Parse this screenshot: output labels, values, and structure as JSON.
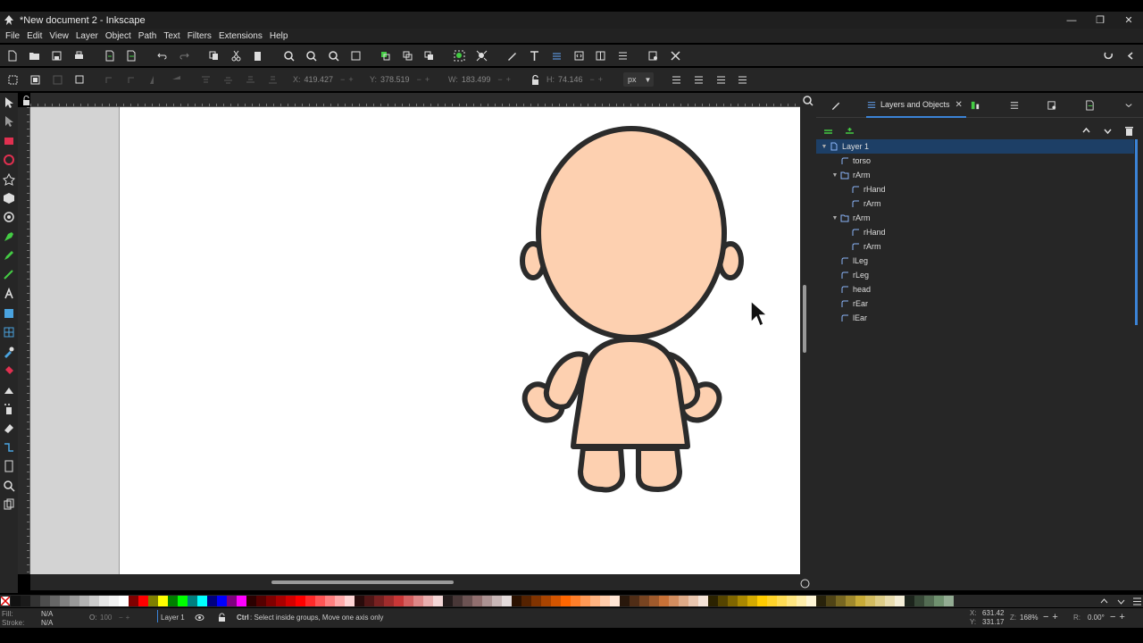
{
  "window": {
    "title": "*New document 2 - Inkscape"
  },
  "menu": [
    "File",
    "Edit",
    "View",
    "Layer",
    "Object",
    "Path",
    "Text",
    "Filters",
    "Extensions",
    "Help"
  ],
  "toolctl": {
    "x_label": "X:",
    "x_value": "419.427",
    "y_label": "Y:",
    "y_value": "378.519",
    "w_label": "W:",
    "w_value": "183.499",
    "h_label": "H:",
    "h_value": "74.146",
    "unit": "px"
  },
  "dock": {
    "active_tab": "Layers and Objects",
    "tree": [
      {
        "label": "Layer 1",
        "depth": 0,
        "kind": "layer",
        "expanded": true,
        "selected": true
      },
      {
        "label": "torso",
        "depth": 1,
        "kind": "path"
      },
      {
        "label": "rArm",
        "depth": 1,
        "kind": "group",
        "expanded": true
      },
      {
        "label": "rHand",
        "depth": 2,
        "kind": "path"
      },
      {
        "label": "rArm",
        "depth": 2,
        "kind": "path"
      },
      {
        "label": "rArm",
        "depth": 1,
        "kind": "group",
        "expanded": true
      },
      {
        "label": "rHand",
        "depth": 2,
        "kind": "path"
      },
      {
        "label": "rArm",
        "depth": 2,
        "kind": "path"
      },
      {
        "label": "lLeg",
        "depth": 1,
        "kind": "path"
      },
      {
        "label": "rLeg",
        "depth": 1,
        "kind": "path"
      },
      {
        "label": "head",
        "depth": 1,
        "kind": "path"
      },
      {
        "label": "rEar",
        "depth": 1,
        "kind": "path"
      },
      {
        "label": "lEar",
        "depth": 1,
        "kind": "path"
      }
    ]
  },
  "palette": [
    "#111111",
    "#1a1a1a",
    "#333333",
    "#4d4d4d",
    "#666666",
    "#808080",
    "#999999",
    "#b3b3b3",
    "#cccccc",
    "#e6e6e6",
    "#f2f2f2",
    "#ffffff",
    "#800000",
    "#ff0000",
    "#808000",
    "#ffff00",
    "#008000",
    "#00ff00",
    "#008080",
    "#00ffff",
    "#000080",
    "#0000ff",
    "#800080",
    "#ff00ff",
    "#2b0000",
    "#550000",
    "#800000",
    "#aa0000",
    "#d40000",
    "#ff0000",
    "#ff2a2a",
    "#ff5555",
    "#ff8080",
    "#ffaaaa",
    "#ffd5d5",
    "#280b0b",
    "#501616",
    "#782121",
    "#a02c2c",
    "#c83737",
    "#d35f5f",
    "#de8787",
    "#e9afaf",
    "#f4d7d7",
    "#241c1c",
    "#483737",
    "#6c5353",
    "#916f6f",
    "#ac9393",
    "#c8b7b7",
    "#e3dbdb",
    "#2b1100",
    "#552200",
    "#803300",
    "#aa4400",
    "#d45500",
    "#ff6600",
    "#ff7f2a",
    "#ff9955",
    "#ffb380",
    "#ffccaa",
    "#ffe6d5",
    "#28170b",
    "#502d16",
    "#784421",
    "#a05a2c",
    "#c87137",
    "#d38d5f",
    "#deaa87",
    "#e9c6af",
    "#f4e3d7",
    "#2b2200",
    "#554400",
    "#806600",
    "#aa8800",
    "#d4aa00",
    "#ffcc00",
    "#ffd42a",
    "#ffdd55",
    "#ffe680",
    "#ffeeaa",
    "#fff6d5",
    "#28220b",
    "#504416",
    "#786721",
    "#a0892c",
    "#c8ab37",
    "#d3bc5f",
    "#decd87",
    "#e9ddaf",
    "#f4eed7",
    "#1c241c",
    "#374837",
    "#536c53",
    "#6f916f",
    "#93ac93"
  ],
  "status": {
    "fill_label": "Fill:",
    "fill_value": "N/A",
    "stroke_label": "Stroke:",
    "stroke_value": "N/A",
    "opacity_label": "O:",
    "opacity_value": "100",
    "layer": "Layer 1",
    "hint_key": "Ctrl",
    "hint_text": ": Select inside groups, Move one axis only",
    "x_label": "X:",
    "x_value": "631.42",
    "y_label": "Y:",
    "y_value": "331.17",
    "zoom_label": "Z:",
    "zoom_value": "168%",
    "rot_label": "R:",
    "rot_value": "0.00°"
  }
}
